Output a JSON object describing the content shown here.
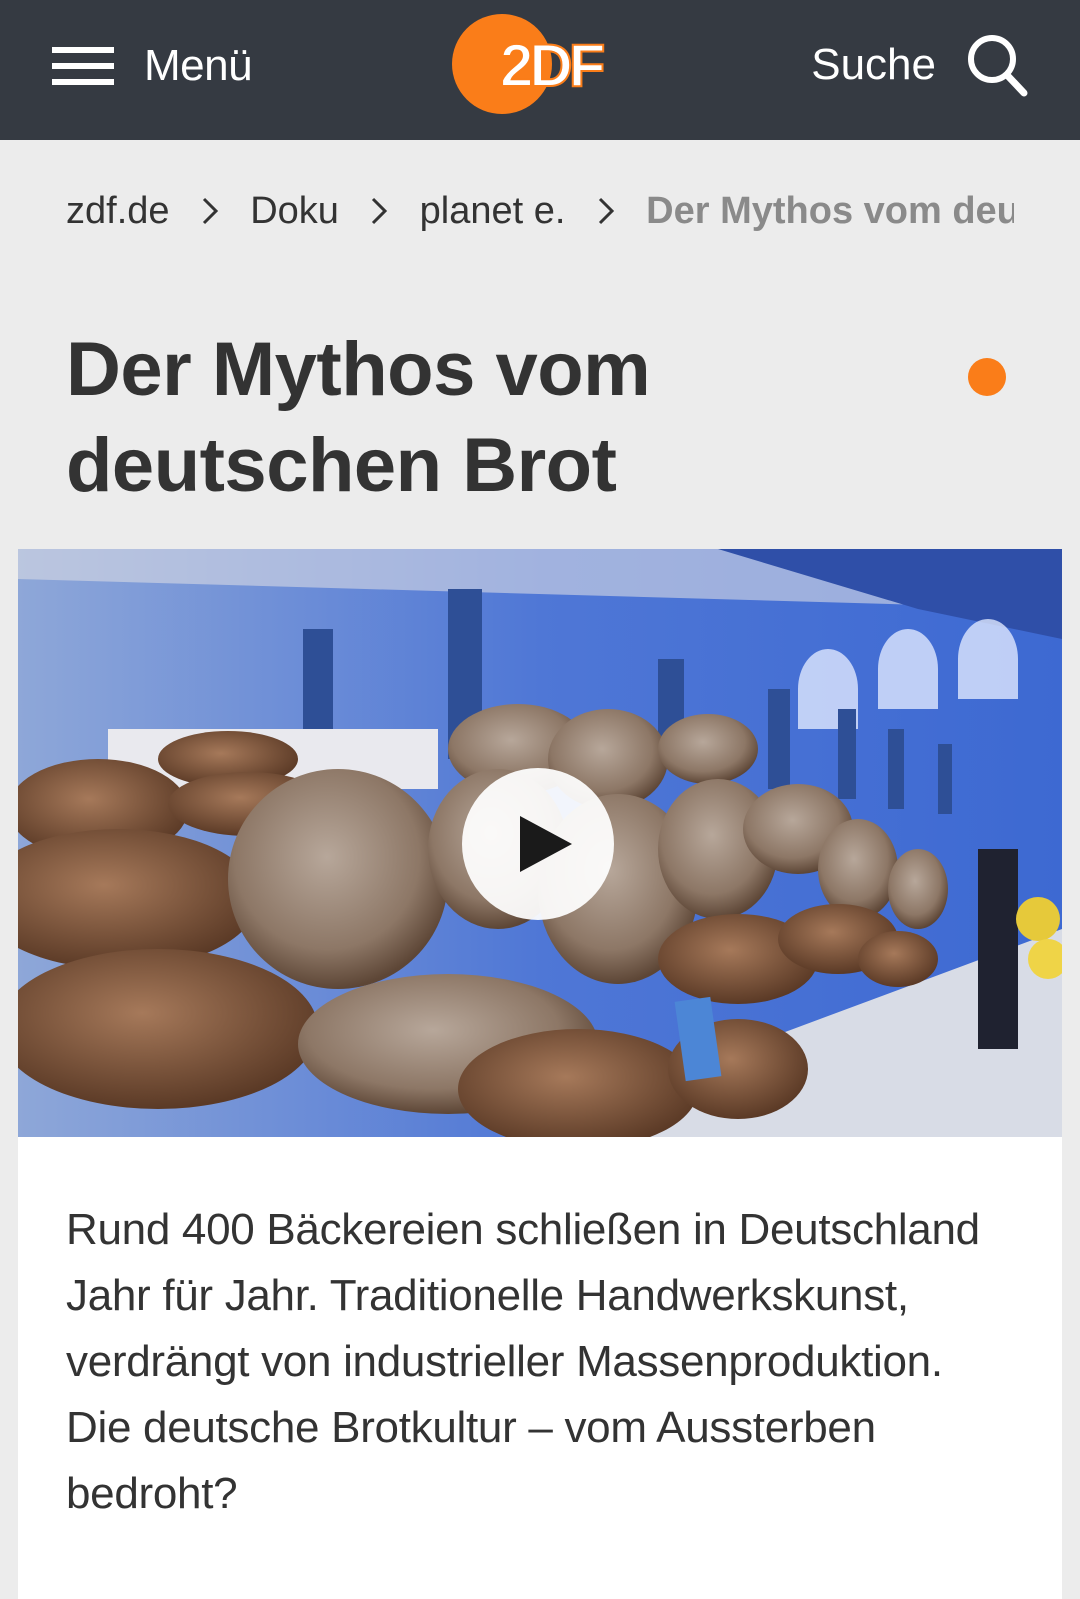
{
  "header": {
    "menu_label": "Menü",
    "logo_text": "2DF",
    "search_label": "Suche",
    "colors": {
      "bar": "#353a42",
      "accent": "#fa7d19"
    }
  },
  "breadcrumb": {
    "items": [
      "zdf.de",
      "Doku",
      "planet e."
    ],
    "current": "Der Mythos vom deu"
  },
  "article": {
    "title_line1": "Der Mythos vom",
    "title_line2": "deutschen Brot",
    "description": "Rund 400 Bäckereien schließen in Deutschland Jahr für Jahr. Traditionelle Handwerkskunst, verdrängt von industrieller Massenproduktion. Die deutsche Brotkultur – vom Aussterben bedroht?"
  },
  "video": {
    "thumbnail": "bread-loaves-exhibition-hall",
    "play_icon": "play-icon"
  }
}
